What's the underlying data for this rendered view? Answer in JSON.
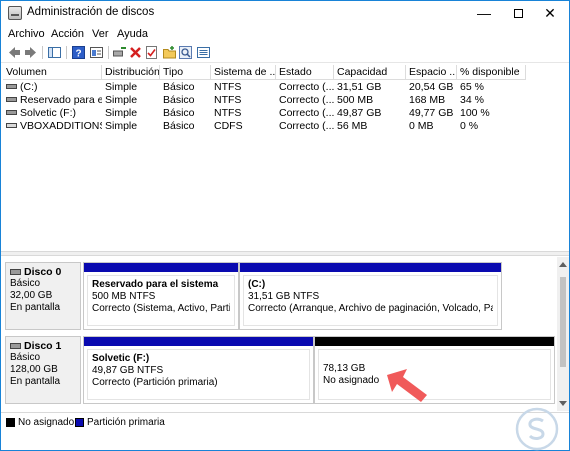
{
  "window": {
    "title": "Administración de discos"
  },
  "controls": {
    "minimize": "—",
    "close": "✕"
  },
  "menu": [
    "Archivo",
    "Acción",
    "Ver",
    "Ayuda"
  ],
  "toolbar": {
    "icons": [
      "back-arrow-icon",
      "forward-arrow-icon",
      "console-tree-icon",
      "help-icon",
      "properties-icon",
      "connect-icon",
      "delete-icon",
      "checklist-icon",
      "new-folder-icon",
      "search-icon",
      "view-list-icon"
    ]
  },
  "volumes": {
    "columns": [
      "Volumen",
      "Distribución",
      "Tipo",
      "Sistema de ...",
      "Estado",
      "Capacidad",
      "Espacio ...",
      "% disponible"
    ],
    "rows": [
      [
        "(C:)",
        "Simple",
        "Básico",
        "NTFS",
        "Correcto (...",
        "31,51 GB",
        "20,54 GB",
        "65 %"
      ],
      [
        "Reservado para el ...",
        "Simple",
        "Básico",
        "NTFS",
        "Correcto (...",
        "500 MB",
        "168 MB",
        "34 %"
      ],
      [
        "Solvetic (F:)",
        "Simple",
        "Básico",
        "NTFS",
        "Correcto (...",
        "49,87 GB",
        "49,77 GB",
        "100 %"
      ],
      [
        "VBOXADDITIONS_...",
        "Simple",
        "Básico",
        "CDFS",
        "Correcto (...",
        "56 MB",
        "0 MB",
        "0 %"
      ]
    ]
  },
  "disks": [
    {
      "name": "Disco 0",
      "type": "Básico",
      "size": "32,00 GB",
      "status": "En pantalla",
      "partitions": [
        {
          "title": "Reservado para el sistema",
          "size_fs": "500 MB NTFS",
          "status": "Correcto (Sistema, Activo, Partición"
        },
        {
          "title": "(C:)",
          "size_fs": "31,51 GB NTFS",
          "status": "Correcto (Arranque, Archivo de paginación, Volcado, Partición"
        }
      ]
    },
    {
      "name": "Disco 1",
      "type": "Básico",
      "size": "128,00 GB",
      "status": "En pantalla",
      "partitions": [
        {
          "title": "Solvetic  (F:)",
          "size_fs": "49,87 GB NTFS",
          "status": "Correcto (Partición primaria)"
        },
        {
          "title": "",
          "size_fs": "78,13 GB",
          "status": "No asignado"
        }
      ]
    }
  ],
  "legend": [
    {
      "label": "No asignado",
      "color": "#000000"
    },
    {
      "label": "Partición primaria",
      "color": "#0a0ab0"
    }
  ],
  "colors": {
    "accent": "#1883d7",
    "primary_partition": "#0a0ab0",
    "unallocated": "#000000",
    "arrow": "#f05a5a"
  }
}
